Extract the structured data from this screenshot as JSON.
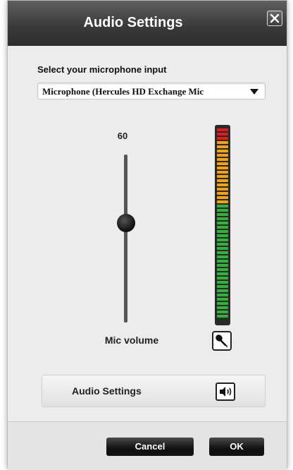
{
  "dialog": {
    "title": "Audio Settings",
    "close_icon": "close-x-icon"
  },
  "microphone": {
    "label": "Select your microphone input",
    "selected": "Microphone (Hercules HD Exchange Mic",
    "dropdown_icon": "chevron-down-icon"
  },
  "volume": {
    "value": "60",
    "label": "Mic volume",
    "level_fraction": 0.6
  },
  "meter": {
    "segments_total": 45,
    "colors": {
      "red": "#e01b1b",
      "orange": "#f0a21c",
      "green": "#33b13a"
    },
    "mic_icon": "microphone-icon"
  },
  "audio_settings_button": {
    "label": "Audio Settings",
    "icon": "speaker-icon"
  },
  "footer": {
    "cancel_label": "Cancel",
    "ok_label": "OK"
  }
}
